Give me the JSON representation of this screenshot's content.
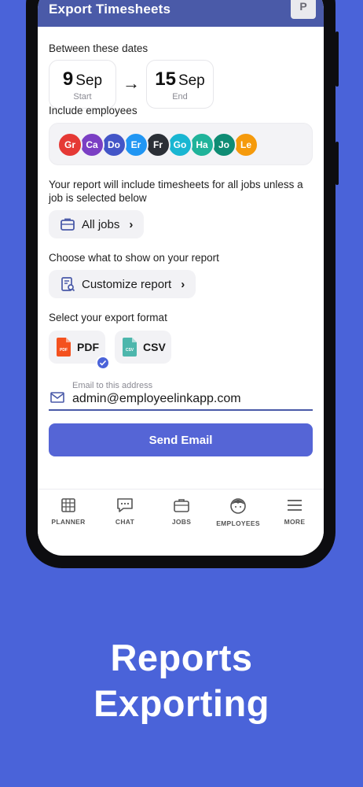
{
  "header": {
    "title": "Export Timesheets",
    "avatar": "P"
  },
  "dates": {
    "label": "Between these dates",
    "start": {
      "day": "9",
      "month": "Sep",
      "label": "Start"
    },
    "end": {
      "day": "15",
      "month": "Sep",
      "label": "End"
    }
  },
  "employees": {
    "label": "Include employees",
    "items": [
      {
        "initials": "Gr",
        "color": "#e53935"
      },
      {
        "initials": "Ca",
        "color": "#7b3fc4"
      },
      {
        "initials": "Do",
        "color": "#4355c7"
      },
      {
        "initials": "Er",
        "color": "#2196f3"
      },
      {
        "initials": "Fr",
        "color": "#2b2f36"
      },
      {
        "initials": "Go",
        "color": "#19b6d2"
      },
      {
        "initials": "Ha",
        "color": "#20b39a"
      },
      {
        "initials": "Jo",
        "color": "#0f8c74"
      },
      {
        "initials": "Le",
        "color": "#f59a0c"
      }
    ]
  },
  "jobs": {
    "label": "Your report will include timesheets for all jobs unless a job is selected below",
    "button": "All jobs"
  },
  "customize": {
    "label": "Choose what to show on your report",
    "button": "Customize report"
  },
  "format": {
    "label": "Select your export format",
    "pdf": "PDF",
    "csv": "CSV",
    "pdf_icon_text": "PDF",
    "csv_icon_text": "CSV",
    "selected": "PDF"
  },
  "email": {
    "hint": "Email to this address",
    "value": "admin@employeelinkapp.com"
  },
  "send_button": "Send Email",
  "tabs": [
    {
      "label": "PLANNER",
      "icon": "calendar-grid-icon"
    },
    {
      "label": "CHAT",
      "icon": "chat-bubble-icon"
    },
    {
      "label": "JOBS",
      "icon": "briefcase-icon"
    },
    {
      "label": "EMPLOYEES",
      "icon": "employee-face-icon"
    },
    {
      "label": "MORE",
      "icon": "hamburger-menu-icon"
    }
  ],
  "caption": {
    "line1": "Reports",
    "line2": "Exporting"
  },
  "colors": {
    "background": "#4a63d9",
    "header": "#4a5aa8",
    "accent": "#5565d6"
  }
}
